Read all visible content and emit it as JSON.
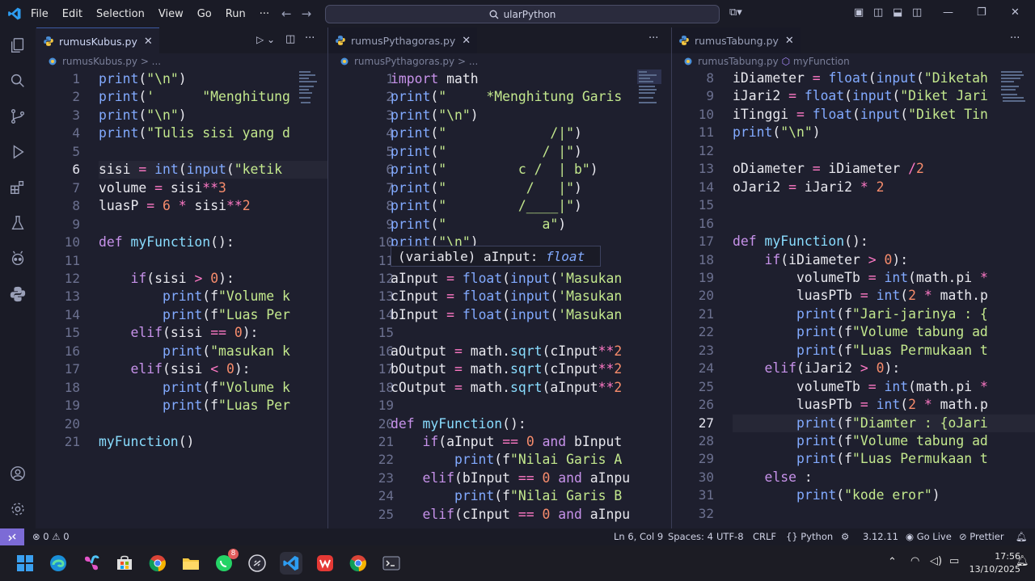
{
  "menu": [
    "File",
    "Edit",
    "Selection",
    "View",
    "Go",
    "Run",
    "···"
  ],
  "search": {
    "label": "ularPython"
  },
  "panes": [
    {
      "tab": "rumusKubus.py",
      "crumb": "rumusKubus.py",
      "crumb_tail": "> ...",
      "lines": [
        {
          "n": "1",
          "t": "print(\"\\n\")"
        },
        {
          "n": "2",
          "t": "print('      \"Menghitung"
        },
        {
          "n": "3",
          "t": "print(\"\\n\")"
        },
        {
          "n": "4",
          "t": "print(\"Tulis sisi yang d"
        },
        {
          "n": "5",
          "t": ""
        },
        {
          "n": "6",
          "t": "sisi = int(input(\"ketik "
        },
        {
          "n": "7",
          "t": "volume = sisi**3"
        },
        {
          "n": "8",
          "t": "luasP = 6 * sisi**2"
        },
        {
          "n": "9",
          "t": ""
        },
        {
          "n": "10",
          "t": "def myFunction():"
        },
        {
          "n": "11",
          "t": ""
        },
        {
          "n": "12",
          "t": "    if(sisi > 0):"
        },
        {
          "n": "13",
          "t": "        print(f\"Volume k"
        },
        {
          "n": "14",
          "t": "        print(f\"Luas Per"
        },
        {
          "n": "15",
          "t": "    elif(sisi == 0):"
        },
        {
          "n": "16",
          "t": "        print(\"masukan k"
        },
        {
          "n": "17",
          "t": "    elif(sisi < 0):"
        },
        {
          "n": "18",
          "t": "        print(f\"Volume k"
        },
        {
          "n": "19",
          "t": "        print(f\"Luas Per"
        },
        {
          "n": "20",
          "t": ""
        },
        {
          "n": "21",
          "t": "myFunction()"
        }
      ]
    },
    {
      "tab": "rumusPythagoras.py",
      "crumb": "rumusPythagoras.py",
      "crumb_tail": "> ...",
      "lines": [
        {
          "n": "1",
          "t": "import math"
        },
        {
          "n": "2",
          "t": "print(\"     *Menghitung Garis"
        },
        {
          "n": "3",
          "t": "print(\"\\n\")"
        },
        {
          "n": "4",
          "t": "print(\"             /|\")"
        },
        {
          "n": "5",
          "t": "print(\"            / |\")"
        },
        {
          "n": "6",
          "t": "print(\"         c /  | b\")"
        },
        {
          "n": "7",
          "t": "print(\"          /   |\")"
        },
        {
          "n": "8",
          "t": "print(\"         /____|\")"
        },
        {
          "n": "9",
          "t": "print(\"            a\")"
        },
        {
          "n": "10",
          "t": "print(\"\\n\")"
        },
        {
          "n": "11",
          "t": ""
        },
        {
          "n": "12",
          "t": "aInput = float(input('Masukan"
        },
        {
          "n": "13",
          "t": "cInput = float(input('Masukan"
        },
        {
          "n": "14",
          "t": "bInput = float(input('Masukan"
        },
        {
          "n": "15",
          "t": ""
        },
        {
          "n": "16",
          "t": "aOutput = math.sqrt(cInput**2"
        },
        {
          "n": "17",
          "t": "bOutput = math.sqrt(cInput**2"
        },
        {
          "n": "18",
          "t": "cOutput = math.sqrt(aInput**2"
        },
        {
          "n": "19",
          "t": ""
        },
        {
          "n": "20",
          "t": "def myFunction():"
        },
        {
          "n": "21",
          "t": "    if(aInput == 0 and bInput"
        },
        {
          "n": "22",
          "t": "        print(f\"Nilai Garis A"
        },
        {
          "n": "23",
          "t": "    elif(bInput == 0 and aInpu"
        },
        {
          "n": "24",
          "t": "        print(f\"Nilai Garis B"
        },
        {
          "n": "25",
          "t": "    elif(cInput == 0 and aInpu"
        }
      ],
      "hover": {
        "prefix": "(variable) aInput: ",
        "type": "float"
      }
    },
    {
      "tab": "rumusTabung.py",
      "crumb": "rumusTabung.py",
      "crumb_tail": "myFunction",
      "lines": [
        {
          "n": "8",
          "t": "iDiameter = float(input(\"Diketah"
        },
        {
          "n": "9",
          "t": "iJari2 = float(input(\"Diket Jari"
        },
        {
          "n": "10",
          "t": "iTinggi = float(input(\"Diket Tin"
        },
        {
          "n": "11",
          "t": "print(\"\\n\")"
        },
        {
          "n": "12",
          "t": ""
        },
        {
          "n": "13",
          "t": "oDiameter = iDiameter /2"
        },
        {
          "n": "14",
          "t": "oJari2 = iJari2 * 2"
        },
        {
          "n": "15",
          "t": ""
        },
        {
          "n": "16",
          "t": ""
        },
        {
          "n": "17",
          "t": "def myFunction():"
        },
        {
          "n": "18",
          "t": "    if(iDiameter > 0):"
        },
        {
          "n": "19",
          "t": "        volumeTb = int(math.pi *"
        },
        {
          "n": "20",
          "t": "        luasPTb = int(2 * math.p"
        },
        {
          "n": "21",
          "t": "        print(f\"Jari-jarinya : {"
        },
        {
          "n": "22",
          "t": "        print(f\"Volume tabung ad"
        },
        {
          "n": "23",
          "t": "        print(f\"Luas Permukaan t"
        },
        {
          "n": "24",
          "t": "    elif(iJari2 > 0):"
        },
        {
          "n": "25",
          "t": "        volumeTb = int(math.pi *"
        },
        {
          "n": "26",
          "t": "        luasPTb = int(2 * math.p"
        },
        {
          "n": "27",
          "t": "        print(f\"Diamter : {oJari"
        },
        {
          "n": "28",
          "t": "        print(f\"Volume tabung ad"
        },
        {
          "n": "29",
          "t": "        print(f\"Luas Permukaan t"
        },
        {
          "n": "30",
          "t": "    else :"
        },
        {
          "n": "31",
          "t": "        print(\"kode eror\")"
        },
        {
          "n": "32",
          "t": ""
        }
      ]
    }
  ],
  "status": {
    "errors": "0",
    "warnings": "0",
    "position": "Ln 6, Col 9",
    "spaces": "Spaces: 4",
    "encoding": "UTF-8",
    "eol": "CRLF",
    "language": "Python",
    "version": "3.12.11",
    "golive": "Go Live",
    "prettier": "Prettier"
  },
  "taskbar": {
    "time": "17:56",
    "date": "13/10/2025",
    "whatsapp_badge": "8"
  },
  "colors": {
    "accent": "#3d59a1",
    "remote": "#7c6bd6",
    "background": "#1e1f2e"
  }
}
